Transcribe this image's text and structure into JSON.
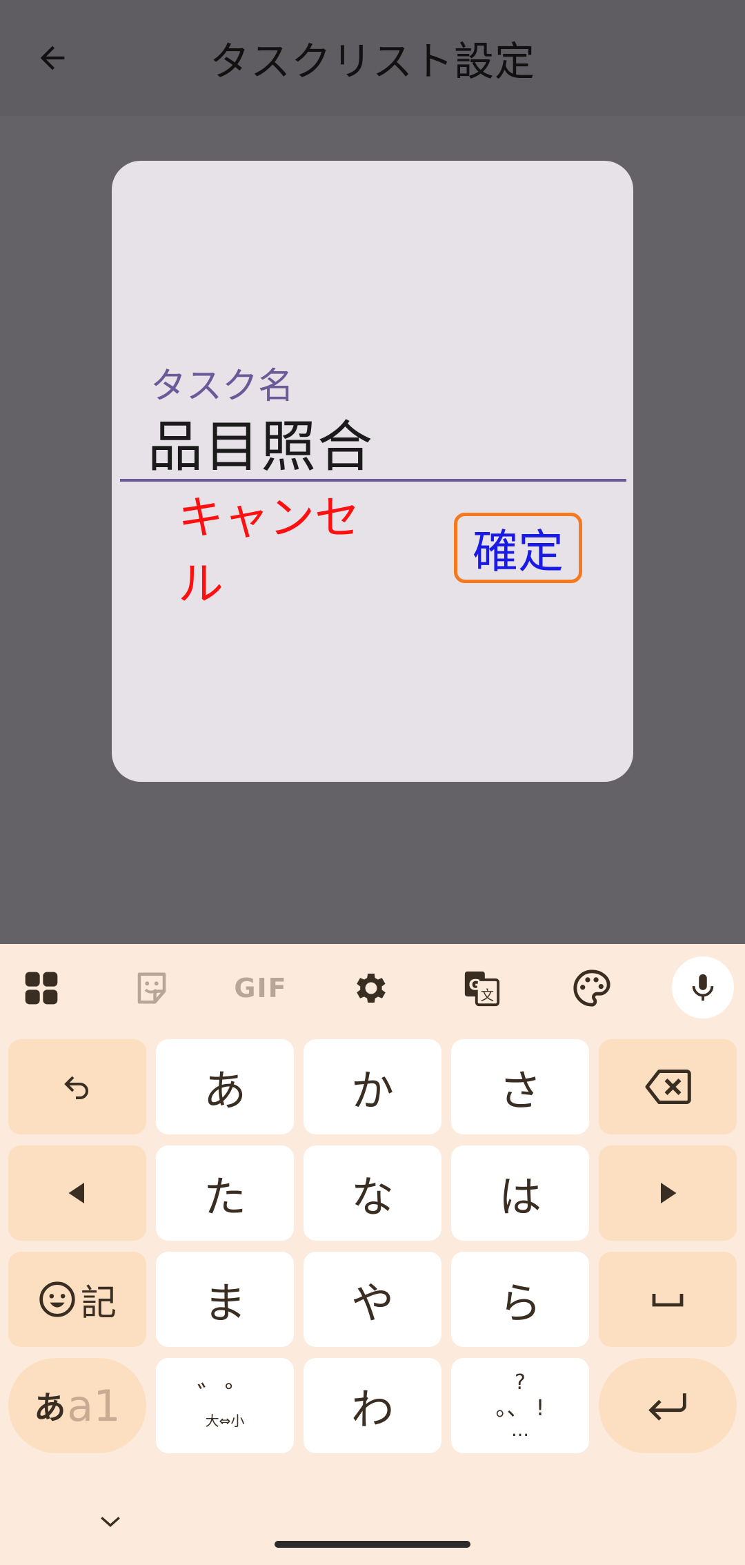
{
  "app_bar": {
    "title": "タスクリスト設定",
    "back_icon": "arrow-left-icon"
  },
  "dialog": {
    "field_label": "タスク名",
    "field_value": "品目照合",
    "cancel_label": "キャンセル",
    "confirm_label": "確定",
    "colors": {
      "cancel": "#ff1010",
      "confirm": "#1a1ae6",
      "confirm_border": "#f47a20",
      "accent": "#6a5a98"
    }
  },
  "keyboard": {
    "toolbar": [
      "apps-grid-icon",
      "sticker-icon",
      "gif-icon",
      "gear-icon",
      "translate-icon",
      "palette-icon",
      "microphone-icon"
    ],
    "gif_label": "GIF",
    "rows": {
      "r1": {
        "undo": "↶",
        "a": "あ",
        "ka": "か",
        "sa": "さ",
        "backspace": "backspace-icon"
      },
      "r2": {
        "left": "◀",
        "ta": "た",
        "na": "な",
        "ha": "は",
        "right": "▶"
      },
      "r3": {
        "emoji_kigo": "記",
        "ma": "ま",
        "ya": "や",
        "ra": "ら",
        "space": "␣"
      },
      "r4": {
        "mode_a": "あ",
        "mode_b": "a1",
        "dakuten_top": "゛゜",
        "dakuten_bottom": "大⇔小",
        "wa": "わ",
        "punct_top": "?",
        "punct_mid": "。、 !",
        "punct_bottom": "…",
        "enter": "enter-icon"
      }
    }
  }
}
